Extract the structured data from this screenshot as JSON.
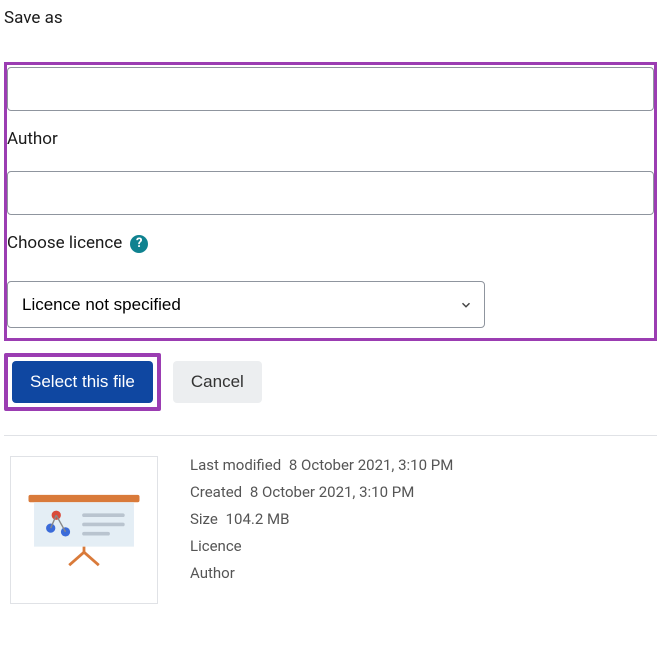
{
  "saveAs": {
    "label": "Save as",
    "value": ""
  },
  "author": {
    "label": "Author",
    "value": ""
  },
  "licence": {
    "label": "Choose licence",
    "selected": "Licence not specified"
  },
  "buttons": {
    "select": "Select this file",
    "cancel": "Cancel"
  },
  "fileMeta": {
    "lastModifiedLabel": "Last modified",
    "lastModifiedValue": "8 October 2021, 3:10 PM",
    "createdLabel": "Created",
    "createdValue": "8 October 2021, 3:10 PM",
    "sizeLabel": "Size",
    "sizeValue": "104.2 MB",
    "licenceLabel": "Licence",
    "licenceValue": "",
    "authorLabel": "Author",
    "authorValue": ""
  }
}
